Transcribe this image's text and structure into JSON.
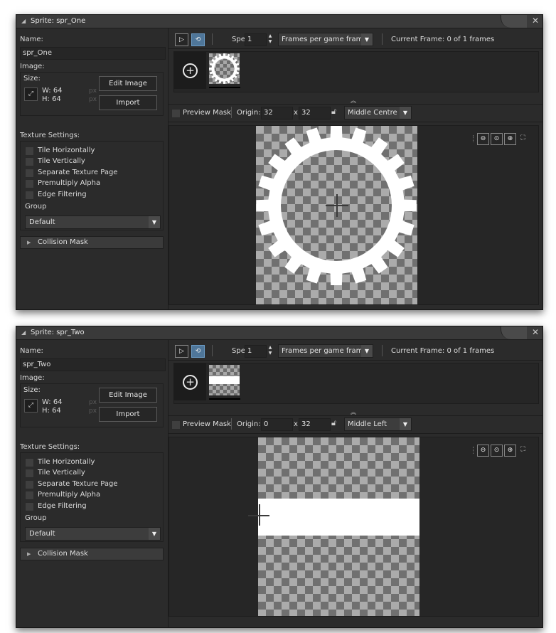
{
  "windows": [
    {
      "title": "Sprite: spr_One",
      "name_label": "Name:",
      "name_value": "spr_One",
      "image_label": "Image:",
      "size_label": "Size:",
      "width_text": "W: 64",
      "height_text": "H: 64",
      "px": "px",
      "edit_image": "Edit Image",
      "import": "Import",
      "texture_settings": "Texture Settings:",
      "options": [
        "Tile Horizontally",
        "Tile Vertically",
        "Separate Texture Page",
        "Premultiply Alpha",
        "Edge Filtering"
      ],
      "group_label": "Group",
      "group_value": "Default",
      "collision_mask": "Collision Mask",
      "speed_label": "Speed:",
      "speed_value": "1",
      "speed_mode": "Frames per game frame",
      "current_frame": "Current Frame: 0 of 1 frames",
      "preview_mask": "Preview Mask",
      "origin_label": "Origin:",
      "origin_x": "32",
      "origin_sep": "x",
      "origin_y": "32",
      "origin_preset": "Middle Centre"
    },
    {
      "title": "Sprite: spr_Two",
      "name_label": "Name:",
      "name_value": "spr_Two",
      "image_label": "Image:",
      "size_label": "Size:",
      "width_text": "W: 64",
      "height_text": "H: 64",
      "px": "px",
      "edit_image": "Edit Image",
      "import": "Import",
      "texture_settings": "Texture Settings:",
      "options": [
        "Tile Horizontally",
        "Tile Vertically",
        "Separate Texture Page",
        "Premultiply Alpha",
        "Edge Filtering"
      ],
      "group_label": "Group",
      "group_value": "Default",
      "collision_mask": "Collision Mask",
      "speed_label": "Speed:",
      "speed_value": "1",
      "speed_mode": "Frames per game frame",
      "current_frame": "Current Frame: 0 of 1 frames",
      "preview_mask": "Preview Mask",
      "origin_label": "Origin:",
      "origin_x": "0",
      "origin_sep": "x",
      "origin_y": "32",
      "origin_preset": "Middle Left"
    }
  ],
  "colors": {
    "panel": "#2b2b2b",
    "toggle_active": "#4f7699"
  },
  "icons": {
    "play": "play-icon",
    "loop": "loop-icon",
    "add_frame": "add-frame-icon",
    "lock": "lock-icon",
    "zoom_out": "zoom-out-icon",
    "zoom_reset": "zoom-reset-icon",
    "zoom_in": "zoom-in-icon",
    "fit": "fit-icon"
  }
}
